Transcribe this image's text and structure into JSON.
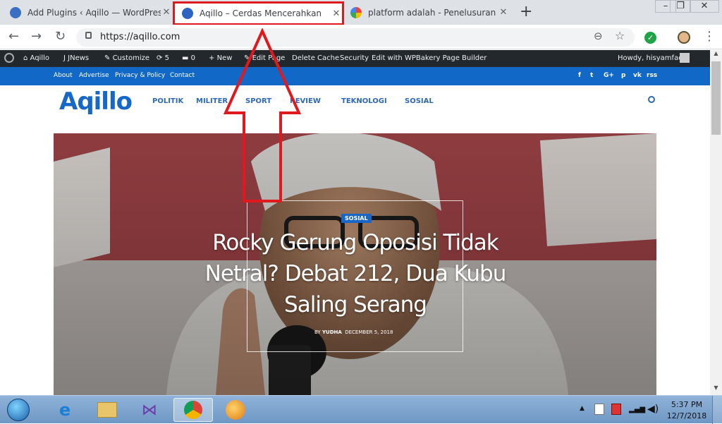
{
  "browser": {
    "tabs": [
      {
        "title": "Add Plugins ‹ Aqillo — WordPress"
      },
      {
        "title": "Aqillo – Cerdas Mencerahkan"
      },
      {
        "title": "platform adalah - Penelusuran Google"
      }
    ],
    "new_tab": "+",
    "close": "✕",
    "url": "https://aqillo.com"
  },
  "adminbar": {
    "site": "Aqillo",
    "jnews": "JNews",
    "customize": "Customize",
    "updates": "5",
    "comments": "0",
    "new": "New",
    "edit_page": "Edit Page",
    "delete_cache": "Delete Cache",
    "security": "Security",
    "wpbakery": "Edit with WPBakery Page Builder",
    "howdy": "Howdy, hisyamfadli"
  },
  "topbar": {
    "links": [
      "About",
      "Advertise",
      "Privacy & Policy",
      "Contact"
    ],
    "social": [
      "f",
      "t",
      "G+",
      "p",
      "vk",
      "rss"
    ]
  },
  "header": {
    "logo": "Aqillo",
    "menu": [
      "POLITIK",
      "MILITER",
      "SPORT",
      "REVIEW",
      "TEKNOLOGI",
      "SOSIAL"
    ]
  },
  "hero": {
    "category": "SOSIAL",
    "headline": "Rocky Gerung Oposisi Tidak Netral? Debat 212, Dua Kubu Saling Serang",
    "author_prefix": "BY",
    "author": "YUDHA",
    "date": "DECEMBER 5, 2018"
  },
  "taskbar": {
    "time": "5:37 PM",
    "date": "12/7/2018"
  },
  "colors": {
    "brand": "#1567c8",
    "topbar": "#1168c6",
    "adminbar": "#23282d",
    "annotation": "#e0191f"
  }
}
